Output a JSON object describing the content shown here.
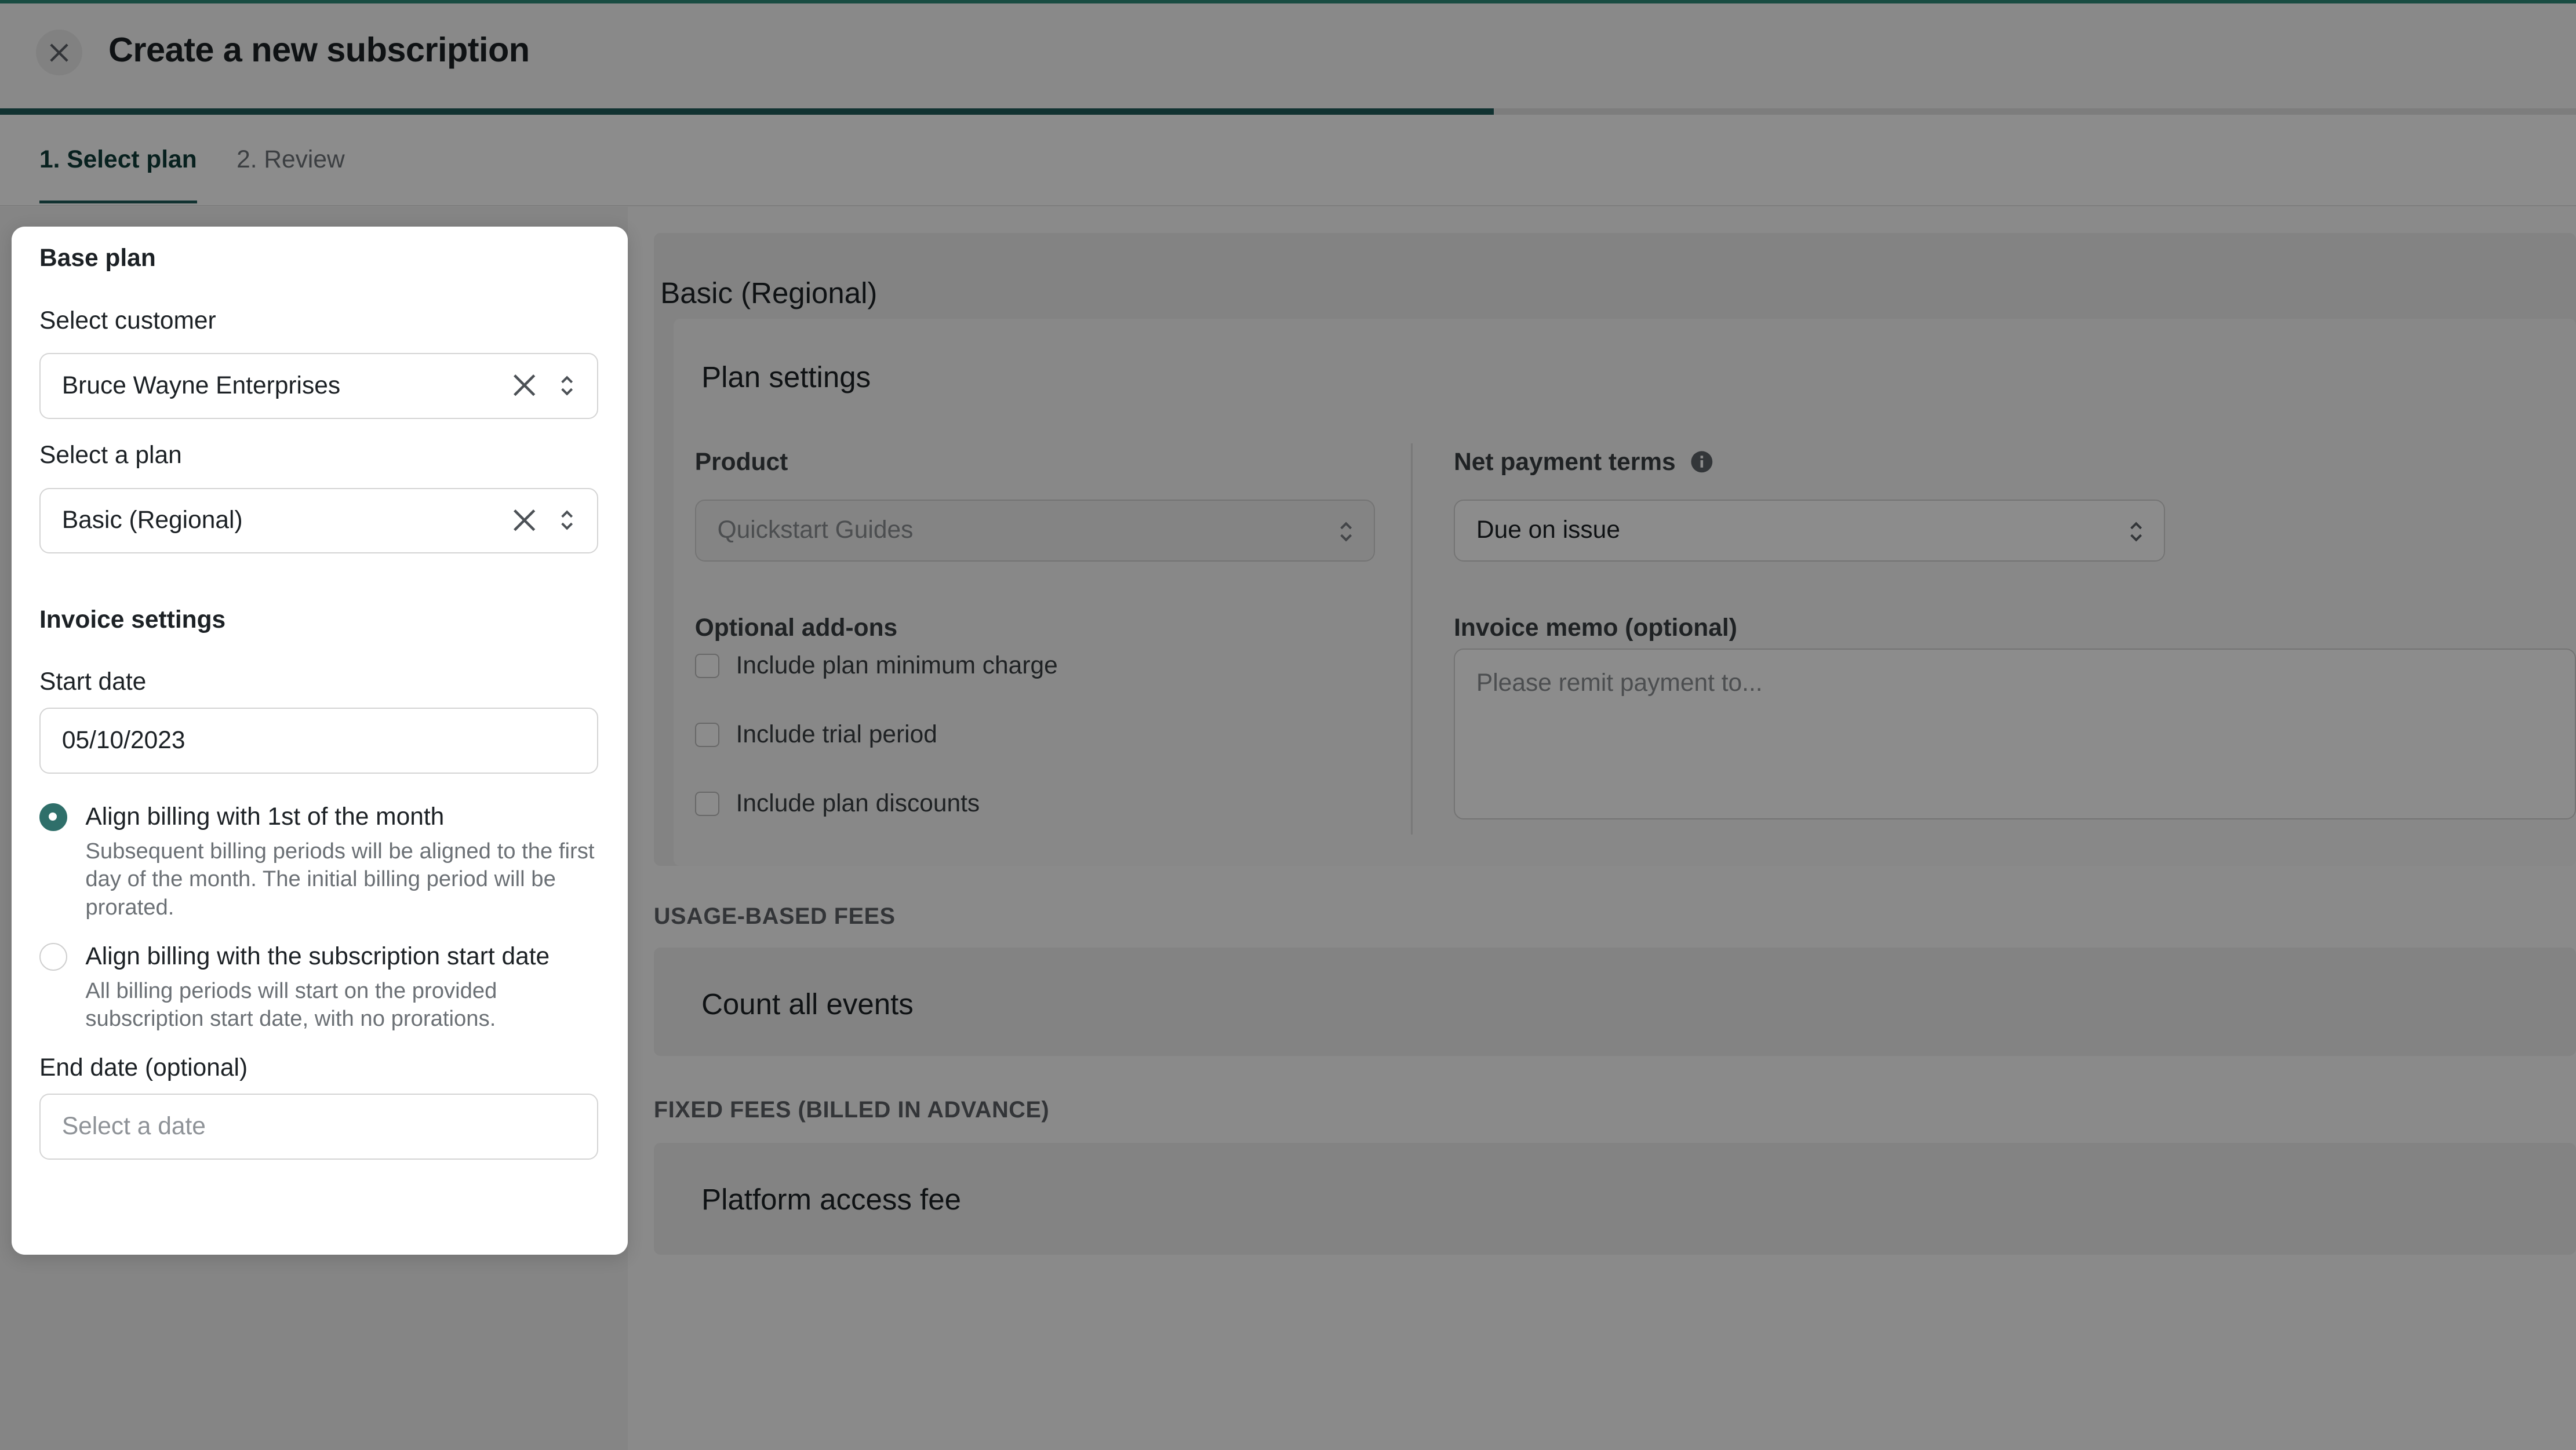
{
  "header": {
    "title": "Create a new subscription",
    "progress_fraction": 0.58,
    "accent_color": "#2f8a78"
  },
  "tabs": [
    {
      "label": "1. Select plan",
      "active": true
    },
    {
      "label": "2. Review",
      "active": false
    }
  ],
  "main": {
    "plan_name": "Basic (Regional)",
    "plan_settings": {
      "title": "Plan settings",
      "product_label": "Product",
      "product_value": "Quickstart Guides",
      "net_terms_label": "Net payment terms",
      "net_terms_value": "Due on issue",
      "addons_label": "Optional add-ons",
      "addons": [
        {
          "label": "Include plan minimum charge",
          "checked": false
        },
        {
          "label": "Include trial period",
          "checked": false
        },
        {
          "label": "Include plan discounts",
          "checked": false
        }
      ],
      "memo_label": "Invoice memo (optional)",
      "memo_placeholder": "Please remit payment to..."
    },
    "usage_section": {
      "title": "USAGE-BASED FEES",
      "item": "Count all events"
    },
    "fixed_section": {
      "title": "FIXED FEES (BILLED IN ADVANCE)",
      "item": "Platform access fee"
    }
  },
  "drawer": {
    "base_plan_title": "Base plan",
    "customer_label": "Select customer",
    "customer_value": "Bruce Wayne Enterprises",
    "plan_label": "Select a plan",
    "plan_value": "Basic (Regional)",
    "invoice_title": "Invoice settings",
    "start_date_label": "Start date",
    "start_date_value": "05/10/2023",
    "align_options": [
      {
        "label": "Align billing with 1st of the month",
        "description": "Subsequent billing periods will be aligned to the first day of the month. The initial billing period will be prorated.",
        "selected": true
      },
      {
        "label": "Align billing with the subscription start date",
        "description": "All billing periods will start on the provided subscription start date, with no prorations.",
        "selected": false
      }
    ],
    "end_date_label": "End date (optional)",
    "end_date_placeholder": "Select a date"
  }
}
